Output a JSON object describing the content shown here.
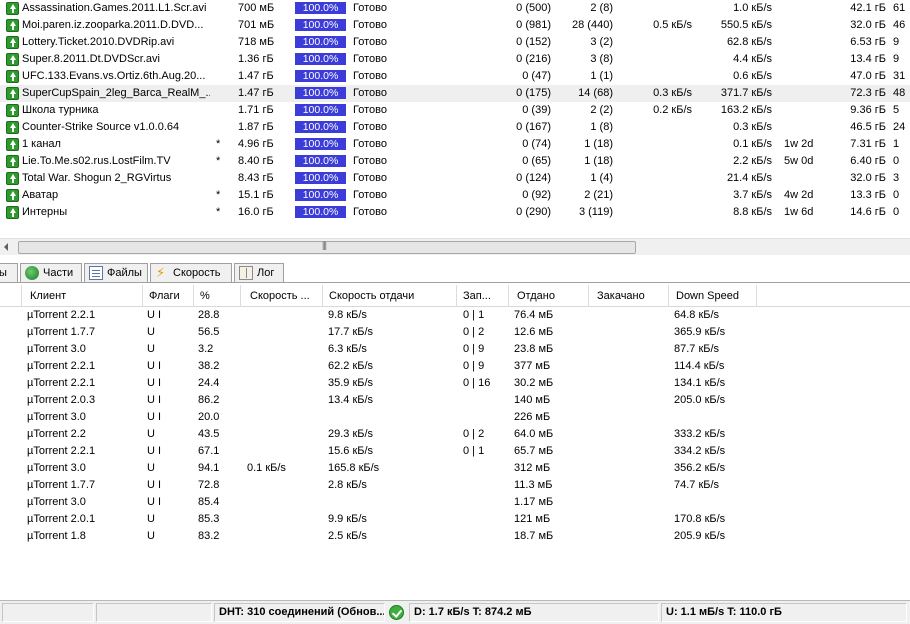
{
  "torrents": [
    {
      "name": "Assassination.Games.2011.L1.Scr.avi",
      "star": "",
      "size": "700 мБ",
      "progress": "100.0%",
      "status": "Готово",
      "seeds": "0 (500)",
      "peers": "2 (8)",
      "down": "",
      "up": "1.0 кБ/s",
      "eta": "",
      "uploaded": "42.1 гБ",
      "ratio": "61"
    },
    {
      "name": "Moi.paren.iz.zooparka.2011.D.DVD...",
      "star": "",
      "size": "701 мБ",
      "progress": "100.0%",
      "status": "Готово",
      "seeds": "0 (981)",
      "peers": "28 (440)",
      "down": "0.5 кБ/s",
      "up": "550.5 кБ/s",
      "eta": "",
      "uploaded": "32.0 гБ",
      "ratio": "46"
    },
    {
      "name": "Lottery.Ticket.2010.DVDRip.avi",
      "star": "",
      "size": "718 мБ",
      "progress": "100.0%",
      "status": "Готово",
      "seeds": "0 (152)",
      "peers": "3 (2)",
      "down": "",
      "up": "62.8 кБ/s",
      "eta": "",
      "uploaded": "6.53 гБ",
      "ratio": "9"
    },
    {
      "name": "Super.8.2011.Dt.DVDScr.avi",
      "star": "",
      "size": "1.36 гБ",
      "progress": "100.0%",
      "status": "Готово",
      "seeds": "0 (216)",
      "peers": "3 (8)",
      "down": "",
      "up": "4.4 кБ/s",
      "eta": "",
      "uploaded": "13.4 гБ",
      "ratio": "9"
    },
    {
      "name": "UFC.133.Evans.vs.Ortiz.6th.Aug.20...",
      "star": "",
      "size": "1.47 гБ",
      "progress": "100.0%",
      "status": "Готово",
      "seeds": "0 (47)",
      "peers": "1 (1)",
      "down": "",
      "up": "0.6 кБ/s",
      "eta": "",
      "uploaded": "47.0 гБ",
      "ratio": "31"
    },
    {
      "name": "SuperCupSpain_2leg_Barca_RealM_...",
      "star": "",
      "size": "1.47 гБ",
      "progress": "100.0%",
      "status": "Готово",
      "seeds": "0 (175)",
      "peers": "14 (68)",
      "down": "0.3 кБ/s",
      "up": "371.7 кБ/s",
      "eta": "",
      "uploaded": "72.3 гБ",
      "ratio": "48"
    },
    {
      "name": "Школа турника",
      "star": "",
      "size": "1.71 гБ",
      "progress": "100.0%",
      "status": "Готово",
      "seeds": "0 (39)",
      "peers": "2 (2)",
      "down": "0.2 кБ/s",
      "up": "163.2 кБ/s",
      "eta": "",
      "uploaded": "9.36 гБ",
      "ratio": "5"
    },
    {
      "name": "Counter-Strike Source v1.0.0.64",
      "star": "",
      "size": "1.87 гБ",
      "progress": "100.0%",
      "status": "Готово",
      "seeds": "0 (167)",
      "peers": "1 (8)",
      "down": "",
      "up": "0.3 кБ/s",
      "eta": "",
      "uploaded": "46.5 гБ",
      "ratio": "24"
    },
    {
      "name": "1 канал",
      "star": "*",
      "size": "4.96 гБ",
      "progress": "100.0%",
      "status": "Готово",
      "seeds": "0 (74)",
      "peers": "1 (18)",
      "down": "",
      "up": "0.1 кБ/s",
      "eta": "1w 2d",
      "uploaded": "7.31 гБ",
      "ratio": "1"
    },
    {
      "name": "Lie.To.Me.s02.rus.LostFilm.TV",
      "star": "*",
      "size": "8.40 гБ",
      "progress": "100.0%",
      "status": "Готово",
      "seeds": "0 (65)",
      "peers": "1 (18)",
      "down": "",
      "up": "2.2 кБ/s",
      "eta": "5w 0d",
      "uploaded": "6.40 гБ",
      "ratio": "0"
    },
    {
      "name": "Total War. Shogun 2_RGVirtus",
      "star": "",
      "size": "8.43 гБ",
      "progress": "100.0%",
      "status": "Готово",
      "seeds": "0 (124)",
      "peers": "1 (4)",
      "down": "",
      "up": "21.4 кБ/s",
      "eta": "",
      "uploaded": "32.0 гБ",
      "ratio": "3"
    },
    {
      "name": "Аватар",
      "star": "*",
      "size": "15.1 гБ",
      "progress": "100.0%",
      "status": "Готово",
      "seeds": "0 (92)",
      "peers": "2 (21)",
      "down": "",
      "up": "3.7 кБ/s",
      "eta": "4w 2d",
      "uploaded": "13.3 гБ",
      "ratio": "0"
    },
    {
      "name": "Интерны",
      "star": "*",
      "size": "16.0 гБ",
      "progress": "100.0%",
      "status": "Готово",
      "seeds": "0 (290)",
      "peers": "3 (119)",
      "down": "",
      "up": "8.8 кБ/s",
      "eta": "1w 6d",
      "uploaded": "14.6 гБ",
      "ratio": "0"
    }
  ],
  "tabs": {
    "peers": "ы",
    "pieces": "Части",
    "files": "Файлы",
    "speed": "Скорость",
    "log": "Лог"
  },
  "peer_columns": {
    "client": "Клиент",
    "flags": "Флаги",
    "pct": "%",
    "downspeed": "Скорость ...",
    "upspeed": "Скорость отдачи",
    "reqs": "Зап...",
    "uploaded": "Отдано",
    "downloaded": "Закачано",
    "peerdl": "Down Speed"
  },
  "peers": [
    {
      "client": "µTorrent 2.2.1",
      "flags": "U I",
      "pct": "28.8",
      "downspeed": "",
      "upspeed": "9.8 кБ/s",
      "reqs": "0 | 1",
      "uploaded": "76.4 мБ",
      "downloaded": "",
      "peerdl": "64.8 кБ/s"
    },
    {
      "client": "µTorrent 1.7.7",
      "flags": "U",
      "pct": "56.5",
      "downspeed": "",
      "upspeed": "17.7 кБ/s",
      "reqs": "0 | 2",
      "uploaded": "12.6 мБ",
      "downloaded": "",
      "peerdl": "365.9 кБ/s"
    },
    {
      "client": "µTorrent 3.0",
      "flags": "U",
      "pct": "3.2",
      "downspeed": "",
      "upspeed": "6.3 кБ/s",
      "reqs": "0 | 9",
      "uploaded": "23.8 мБ",
      "downloaded": "",
      "peerdl": "87.7 кБ/s"
    },
    {
      "client": "µTorrent 2.2.1",
      "flags": "U I",
      "pct": "38.2",
      "downspeed": "",
      "upspeed": "62.2 кБ/s",
      "reqs": "0 | 9",
      "uploaded": "377 мБ",
      "downloaded": "",
      "peerdl": "114.4 кБ/s"
    },
    {
      "client": "µTorrent 2.2.1",
      "flags": "U I",
      "pct": "24.4",
      "downspeed": "",
      "upspeed": "35.9 кБ/s",
      "reqs": "0 | 16",
      "uploaded": "30.2 мБ",
      "downloaded": "",
      "peerdl": "134.1 кБ/s"
    },
    {
      "client": "µTorrent 2.0.3",
      "flags": "U I",
      "pct": "86.2",
      "downspeed": "",
      "upspeed": "13.4 кБ/s",
      "reqs": "",
      "uploaded": "140 мБ",
      "downloaded": "",
      "peerdl": "205.0 кБ/s"
    },
    {
      "client": "µTorrent 3.0",
      "flags": "U I",
      "pct": "20.0",
      "downspeed": "",
      "upspeed": "",
      "reqs": "",
      "uploaded": "226 мБ",
      "downloaded": "",
      "peerdl": ""
    },
    {
      "client": "µTorrent 2.2",
      "flags": "U",
      "pct": "43.5",
      "downspeed": "",
      "upspeed": "29.3 кБ/s",
      "reqs": "0 | 2",
      "uploaded": "64.0 мБ",
      "downloaded": "",
      "peerdl": "333.2 кБ/s"
    },
    {
      "client": "µTorrent 2.2.1",
      "flags": "U I",
      "pct": "67.1",
      "downspeed": "",
      "upspeed": "15.6 кБ/s",
      "reqs": "0 | 1",
      "uploaded": "65.7 мБ",
      "downloaded": "",
      "peerdl": "334.2 кБ/s"
    },
    {
      "client": "µTorrent 3.0",
      "flags": "U",
      "pct": "94.1",
      "downspeed": "0.1 кБ/s",
      "upspeed": "165.8 кБ/s",
      "reqs": "",
      "uploaded": "312 мБ",
      "downloaded": "",
      "peerdl": "356.2 кБ/s"
    },
    {
      "client": "µTorrent 1.7.7",
      "flags": "U I",
      "pct": "72.8",
      "downspeed": "",
      "upspeed": "2.8 кБ/s",
      "reqs": "",
      "uploaded": "11.3 мБ",
      "downloaded": "",
      "peerdl": "74.7 кБ/s"
    },
    {
      "client": "µTorrent 3.0",
      "flags": "U I",
      "pct": "85.4",
      "downspeed": "",
      "upspeed": "",
      "reqs": "",
      "uploaded": "1.17 мБ",
      "downloaded": "",
      "peerdl": ""
    },
    {
      "client": "µTorrent 2.0.1",
      "flags": "U",
      "pct": "85.3",
      "downspeed": "",
      "upspeed": "9.9 кБ/s",
      "reqs": "",
      "uploaded": "121 мБ",
      "downloaded": "",
      "peerdl": "170.8 кБ/s"
    },
    {
      "client": "µTorrent 1.8",
      "flags": "U",
      "pct": "83.2",
      "downspeed": "",
      "upspeed": "2.5 кБ/s",
      "reqs": "",
      "uploaded": "18.7 мБ",
      "downloaded": "",
      "peerdl": "205.9 кБ/s"
    }
  ],
  "statusbar": {
    "dht": "DHT: 310 соединений  (Обнов...",
    "download": "D: 1.7 кБ/s T: 874.2 мБ",
    "upload": "U: 1.1 мБ/s T: 110.0 гБ"
  },
  "scrollbar": {
    "grip": "|||"
  }
}
